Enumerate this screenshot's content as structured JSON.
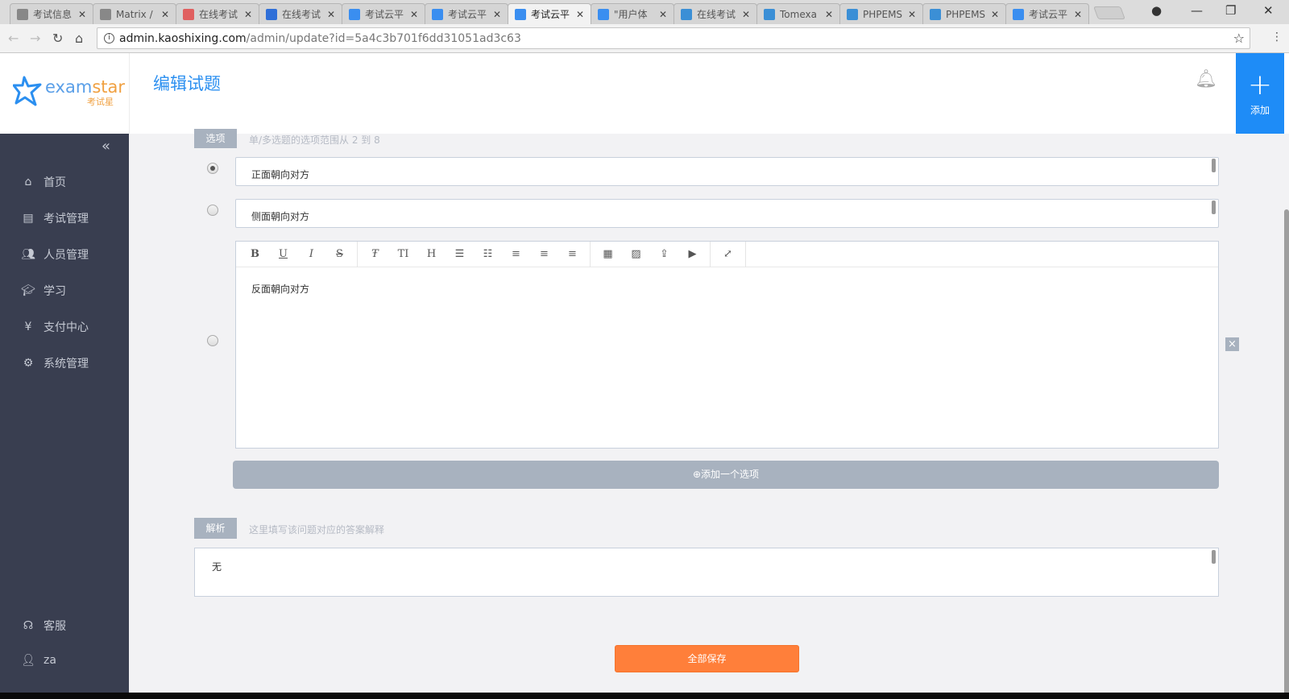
{
  "browser": {
    "tabs": [
      {
        "title": "考试信息",
        "favicon": "page-icon",
        "color": "#888"
      },
      {
        "title": "Matrix /",
        "favicon": "page-icon",
        "color": "#888"
      },
      {
        "title": "在线考试",
        "favicon": "red-icon",
        "color": "#e06060"
      },
      {
        "title": "在线考试",
        "favicon": "baidu-icon",
        "color": "#2f6fd8"
      },
      {
        "title": "考试云平",
        "favicon": "examstar-icon",
        "color": "#3a8ef0"
      },
      {
        "title": "考试云平",
        "favicon": "examstar-icon",
        "color": "#3a8ef0"
      },
      {
        "title": "考试云平",
        "favicon": "examstar-icon",
        "color": "#3a8ef0",
        "active": true
      },
      {
        "title": "\"用户体",
        "favicon": "examstar-icon",
        "color": "#3a8ef0"
      },
      {
        "title": "在线考试",
        "favicon": "phpems-icon",
        "color": "#3b8fd6"
      },
      {
        "title": "Tomexa",
        "favicon": "phpems-icon",
        "color": "#3b8fd6"
      },
      {
        "title": "PHPEMS",
        "favicon": "phpems-icon",
        "color": "#3b8fd6"
      },
      {
        "title": "PHPEMS",
        "favicon": "phpems-icon",
        "color": "#3b8fd6"
      },
      {
        "title": "考试云平",
        "favicon": "examstar-icon",
        "color": "#3a8ef0"
      }
    ],
    "url_host": "admin.kaoshixing.com",
    "url_path": "/admin/update?id=5a4c3b701f6dd31051ad3c63"
  },
  "header": {
    "logo_en_1": "exam",
    "logo_en_2": "star",
    "logo_cn": "考试星",
    "title": "编辑试题",
    "add_label": "添加"
  },
  "sidebar": {
    "items": [
      {
        "label": "首页",
        "icon": "home-icon"
      },
      {
        "label": "考试管理",
        "icon": "exam-icon"
      },
      {
        "label": "人员管理",
        "icon": "users-icon"
      },
      {
        "label": "学习",
        "icon": "graduation-cap-icon"
      },
      {
        "label": "支付中心",
        "icon": "money-bag-icon"
      },
      {
        "label": "系统管理",
        "icon": "gears-icon"
      }
    ],
    "bottom": [
      {
        "label": "客服",
        "icon": "support-icon"
      },
      {
        "label": "za",
        "icon": "user-icon"
      }
    ]
  },
  "options_section": {
    "label": "选项",
    "hint": "单/多选题的选项范围从 2 到 8",
    "options": [
      {
        "text": "正面朝向对方",
        "selected": true
      },
      {
        "text": "侧面朝向对方",
        "selected": false
      },
      {
        "text": "反面朝向对方",
        "selected": false
      }
    ],
    "add_option": "⊕添加一个选项"
  },
  "analysis_section": {
    "label": "解析",
    "hint": "这里填写该问题对应的答案解释",
    "value": "无"
  },
  "save_label": "全部保存",
  "colors": {
    "accent": "#1e8cf7",
    "sidebar": "#393e50",
    "save": "#ff7f3a",
    "label": "#a8b2bf"
  }
}
